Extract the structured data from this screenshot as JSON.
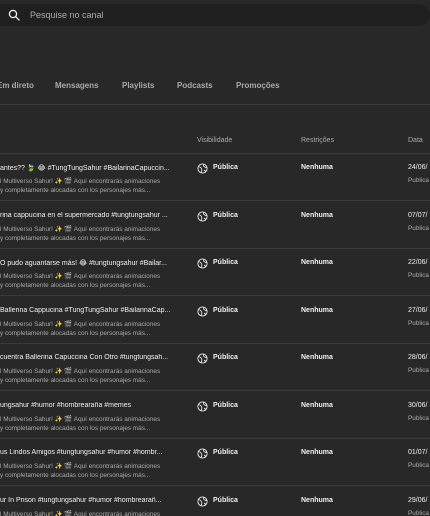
{
  "search": {
    "placeholder": "Pesquise no canal"
  },
  "tabs": [
    "Em direto",
    "Mensagens",
    "Playlists",
    "Podcasts",
    "Promoções"
  ],
  "columns": {
    "visibility": "Visibilidade",
    "restrictions": "Restrições",
    "date": "Data"
  },
  "rows": [
    {
      "title": "antes?? 🍃 😂 #TungTungSahur #BailarinaCapuccin...",
      "desc": "l Multiverso Sahur! ✨ 🎬 Aquí encontrarás animaciones\ny completamente alocadas con los personajes más...",
      "visibility": "Pública",
      "restrictions": "Nenhuma",
      "date": "24/06/",
      "status": "Publica"
    },
    {
      "title": "rina cappucina en el supermercado #tungtungsahur ...",
      "desc": "l Multiverso Sahur! ✨ 🎬 Aquí encontrarás animaciones\ny completamente alocadas con los personajes más...",
      "visibility": "Pública",
      "restrictions": "Nenhuma",
      "date": "07/07/",
      "status": "Publica"
    },
    {
      "title": "O pudo aguantarse más! 😂 #tungtungsahur #Bailar...",
      "desc": "l Multiverso Sahur! ✨ 🎬 Aquí encontrarás animaciones\ny completamente alocadas con los personajes más...",
      "visibility": "Pública",
      "restrictions": "Nenhuma",
      "date": "22/06/",
      "status": "Publica"
    },
    {
      "title": "Ballerina Cappucina #TungTungSahur #BailarinaCap...",
      "desc": "l Multiverso Sahur! ✨ 🎬 Aquí encontrarás animaciones\ny completamente alocadas con los personajes más...",
      "visibility": "Pública",
      "restrictions": "Nenhuma",
      "date": "27/06/",
      "status": "Publica"
    },
    {
      "title": "cuentra Ballerina Capuccina Con Otro #tungtungsah...",
      "desc": "l Multiverso Sahur! ✨ 🎬 Aquí encontrarás animaciones\ny completamente alocadas con los personajes más...",
      "visibility": "Pública",
      "restrictions": "Nenhuma",
      "date": "28/06/",
      "status": "Publica"
    },
    {
      "title": "ungsahur #humor #hombrearaña #memes",
      "desc": "l Multiverso Sahur! ✨ 🎬 Aquí encontrarás animaciones\ny completamente alocadas con los personajes más...",
      "visibility": "Pública",
      "restrictions": "Nenhuma",
      "date": "30/06/",
      "status": "Publica"
    },
    {
      "title": "us Lindos Amigos #tungtungsahur #humor #hombr...",
      "desc": "l Multiverso Sahur! ✨ 🎬 Aquí encontrarás animaciones\ny completamente alocadas con los personajes más...",
      "visibility": "Pública",
      "restrictions": "Nenhuma",
      "date": "01/07/",
      "status": "Publica"
    },
    {
      "title": "ur In Prison #tungtungsahur #humor #hombrearañ...",
      "desc": "l Multiverso Sahur! ✨ 🎬 Aquí encontrarás animaciones\ny completamente alocadas con los personajes más...",
      "visibility": "Pública",
      "restrictions": "Nenhuma",
      "date": "29/06/",
      "status": "Publica"
    }
  ]
}
